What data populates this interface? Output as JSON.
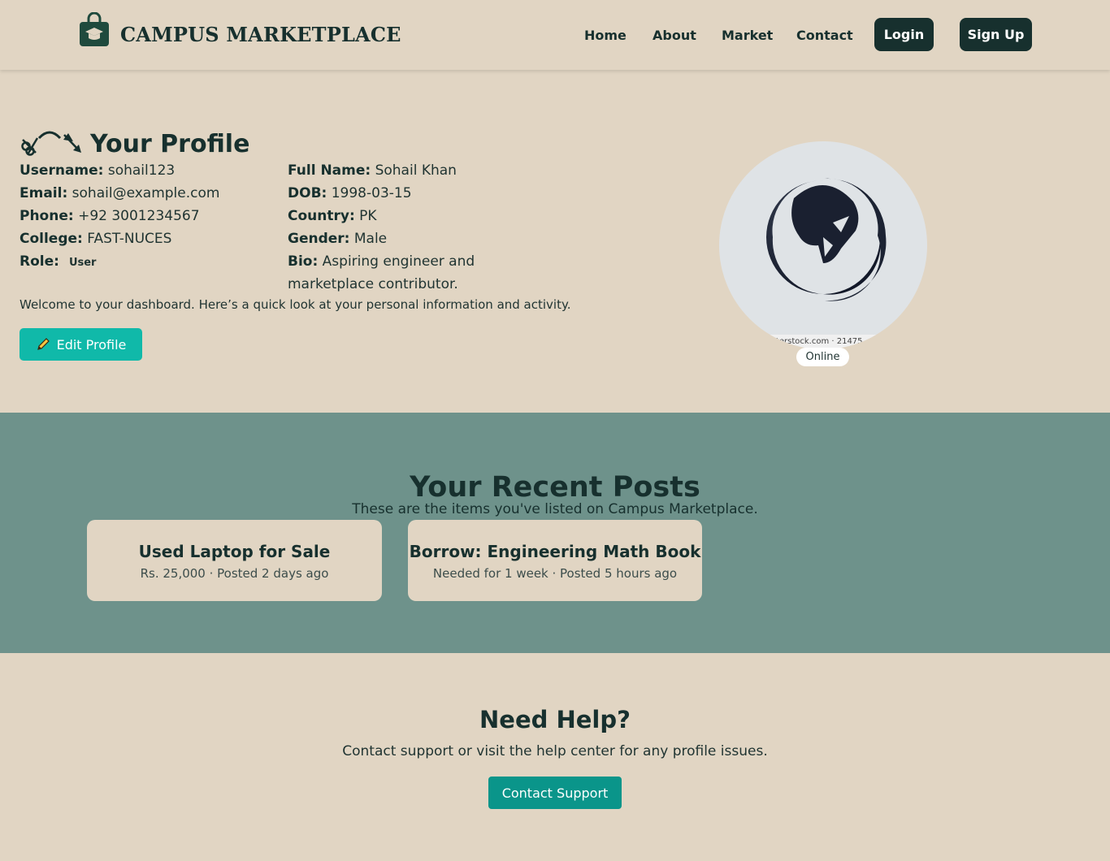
{
  "header": {
    "brand": "CAMPUS MARKETPLACE",
    "nav": [
      "Home",
      "About",
      "Market",
      "Contact"
    ],
    "login_label": "Login",
    "signup_label": "Sign Up"
  },
  "profile": {
    "title": "Your Profile",
    "left_fields": [
      {
        "label": "Username:",
        "value": "sohail123"
      },
      {
        "label": "Email:",
        "value": "sohail@example.com"
      },
      {
        "label": "Phone:",
        "value": "+92 3001234567"
      },
      {
        "label": "College:",
        "value": "FAST-NUCES"
      },
      {
        "label": "Role:",
        "value": "User"
      }
    ],
    "right_fields": [
      {
        "label": "Full Name:",
        "value": "Sohail Khan"
      },
      {
        "label": "DOB:",
        "value": "1998-03-15"
      },
      {
        "label": "Country:",
        "value": "PK"
      },
      {
        "label": "Gender:",
        "value": "Male"
      },
      {
        "label": "Bio:",
        "value": "Aspiring engineer and marketplace contributor."
      }
    ],
    "welcome": "Welcome to your dashboard. Here’s a quick look at your personal information and activity.",
    "edit_label": "Edit Profile",
    "avatar_watermark": "terstock.com · 21475...",
    "status": "Online"
  },
  "posts": {
    "title": "Your Recent Posts",
    "subtitle": "These are the items you've listed on Campus Marketplace.",
    "items": [
      {
        "title": "Used Laptop for Sale",
        "meta": "Rs. 25,000 · Posted 2 days ago"
      },
      {
        "title": "Borrow: Engineering Math Book",
        "meta": "Needed for 1 week · Posted 5 hours ago"
      }
    ]
  },
  "help": {
    "title": "Need Help?",
    "text": "Contact support or visit the help center for any profile issues.",
    "button_label": "Contact Support"
  },
  "icons": {
    "logo": "shopping-bag-graduation-cap-icon",
    "title_icon": "scissors-arc-icon",
    "edit": "pencil-icon"
  }
}
